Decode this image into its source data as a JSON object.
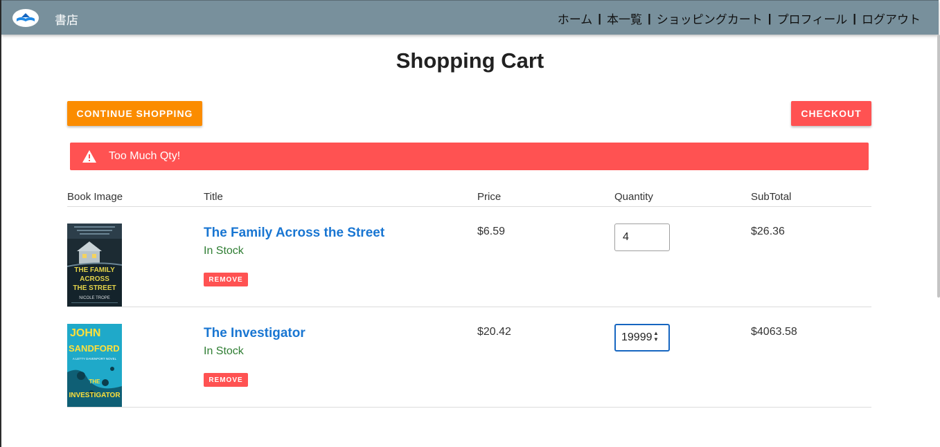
{
  "header": {
    "brand": "書店",
    "nav": [
      "ホーム",
      "本一覧",
      "ショッピングカート",
      "プロフィール",
      "ログアウト"
    ],
    "separator": "|"
  },
  "page": {
    "title": "Shopping Cart",
    "continue_label": "CONTINUE SHOPPING",
    "checkout_label": "CHECKOUT",
    "alert_text": "Too Much Qty!"
  },
  "table": {
    "headers": [
      "Book Image",
      "Title",
      "Price",
      "Quantity",
      "SubTotal"
    ],
    "rows": [
      {
        "title": "The Family Across the Street",
        "stock": "In Stock",
        "remove_label": "REMOVE",
        "price": "$6.59",
        "quantity": "4",
        "subtotal": "$26.36",
        "cover_lines": [
          "THE FAMILY",
          "ACROSS",
          "THE STREET"
        ],
        "cover_author": "NICOLE TROPE"
      },
      {
        "title": "The Investigator",
        "stock": "In Stock",
        "remove_label": "REMOVE",
        "price": "$20.42",
        "quantity": "19999",
        "subtotal": "$4063.58",
        "cover_lines": [
          "JOHN",
          "SANDFORD",
          "THE",
          "INVESTIGATOR"
        ],
        "cover_subtitle": "A LETTY DAVENPORT NOVEL"
      }
    ]
  },
  "colors": {
    "navbar": "#78909c",
    "continue": "#fb8c00",
    "danger": "#ff5252",
    "link": "#1976d2",
    "in_stock": "#2e7d32"
  }
}
